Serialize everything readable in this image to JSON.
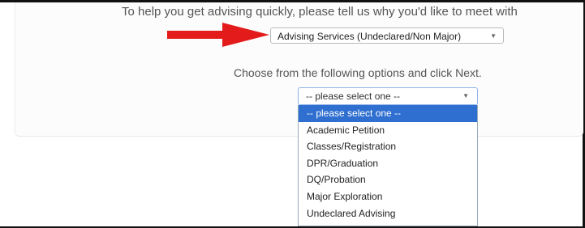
{
  "prompt_text": "To help you get advising quickly, please tell us why you'd like to meet with",
  "reason_select": {
    "value": "Advising Services (Undeclared/Non Major)"
  },
  "choose_text": "Choose from the following options and click Next.",
  "option_select": {
    "value": "-- please select one --",
    "options": [
      "-- please select one --",
      "Academic Petition",
      "Classes/Registration",
      "DPR/Graduation",
      "DQ/Probation",
      "Major Exploration",
      "Undeclared Advising"
    ],
    "highlighted_index": 0
  },
  "colors": {
    "arrow": "#e31b1b",
    "highlight": "#2f6fd0"
  },
  "icons": {
    "annotation_arrow": "red-arrow-icon",
    "caret": "chevron-down-icon"
  }
}
